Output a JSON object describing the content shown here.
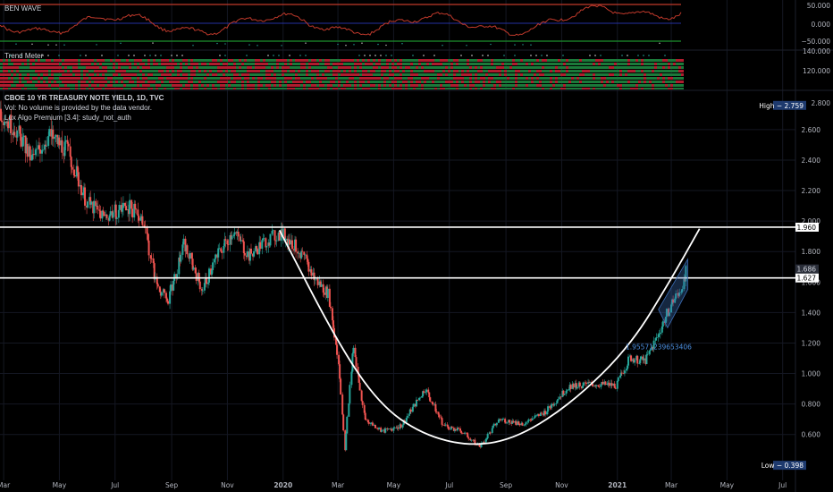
{
  "colors": {
    "background": "#000000",
    "grid": "#141722",
    "candle_up": "#26a69a",
    "candle_down": "#ef5350",
    "wave_line": "#c0392b",
    "wave_zero": "#2f3fd6",
    "wave_lower": "#1c8f2e",
    "wave_upper": "#c0392b",
    "cup_line": "#ffffff",
    "channel": "#3d6fb8",
    "annotation": "#4c8fe0",
    "high_low_tag": "#1e3a6e"
  },
  "header": {
    "ben_wave_title": "BEN WAVE",
    "trend_meter_title": "Trend Meter",
    "symbol_line": "CBOE 10 YR TREASURY NOTE YIELD, 1D, TVC",
    "vol_line": "Vol: No volume is provided by the data vendor.",
    "algo_line": "Lux Algo Premium [3.4]: study_not_auth"
  },
  "ben_wave_axis": [
    "50.000",
    "0.000",
    "−50.000"
  ],
  "trend_meter_axis": [
    "140.000",
    "120.000"
  ],
  "annotation_text": "1.95571239653406",
  "price_tags": {
    "high": "High − 2.759",
    "low": "Low − 0.398",
    "level_upper": "1.960",
    "level_lower": "1.627",
    "last_price": "1.686",
    "cut_label": "2.800",
    "cut_label_2": "1.600"
  },
  "chart_data": {
    "type": "candlestick",
    "title": "CBOE 10 YR TREASURY NOTE YIELD, 1D, TVC",
    "y_ticks": [
      2.6,
      2.4,
      2.2,
      2.0,
      1.8,
      1.4,
      1.2,
      1.0,
      0.8,
      0.6
    ],
    "y_tick_labels": [
      "2.600",
      "2.400",
      "2.200",
      "2.000",
      "1.800",
      "1.400",
      "1.200",
      "1.000",
      "0.800",
      "0.600"
    ],
    "ylim": [
      0.34,
      2.84
    ],
    "x_labels": [
      "Mar",
      "May",
      "Jul",
      "Sep",
      "Nov",
      "2020",
      "Mar",
      "May",
      "Jul",
      "Sep",
      "Nov",
      "2021",
      "Mar",
      "May",
      "Jul"
    ],
    "x_label_dates": [
      "2019-03-01",
      "2019-05-01",
      "2019-07-01",
      "2019-09-01",
      "2019-11-01",
      "2020-01-01",
      "2020-03-01",
      "2020-05-01",
      "2020-07-01",
      "2020-09-01",
      "2020-11-01",
      "2021-01-01",
      "2021-03-01",
      "2021-05-01",
      "2021-07-01"
    ],
    "x_range": [
      "2019-02-25",
      "2021-07-15"
    ],
    "grid": true,
    "price_path": [
      {
        "date": "2019-02-25",
        "y": 2.72
      },
      {
        "date": "2019-03-15",
        "y": 2.6
      },
      {
        "date": "2019-04-01",
        "y": 2.4
      },
      {
        "date": "2019-04-20",
        "y": 2.56
      },
      {
        "date": "2019-05-10",
        "y": 2.47
      },
      {
        "date": "2019-06-01",
        "y": 2.12
      },
      {
        "date": "2019-06-20",
        "y": 2.03
      },
      {
        "date": "2019-07-15",
        "y": 2.1
      },
      {
        "date": "2019-08-01",
        "y": 2.02
      },
      {
        "date": "2019-08-15",
        "y": 1.6
      },
      {
        "date": "2019-08-28",
        "y": 1.47
      },
      {
        "date": "2019-09-15",
        "y": 1.85
      },
      {
        "date": "2019-10-05",
        "y": 1.55
      },
      {
        "date": "2019-10-20",
        "y": 1.76
      },
      {
        "date": "2019-11-08",
        "y": 1.94
      },
      {
        "date": "2019-11-25",
        "y": 1.77
      },
      {
        "date": "2019-12-15",
        "y": 1.88
      },
      {
        "date": "2019-12-31",
        "y": 1.92
      },
      {
        "date": "2020-01-20",
        "y": 1.8
      },
      {
        "date": "2020-02-05",
        "y": 1.62
      },
      {
        "date": "2020-02-20",
        "y": 1.52
      },
      {
        "date": "2020-03-02",
        "y": 1.08
      },
      {
        "date": "2020-03-09",
        "y": 0.5
      },
      {
        "date": "2020-03-18",
        "y": 1.18
      },
      {
        "date": "2020-03-31",
        "y": 0.7
      },
      {
        "date": "2020-04-20",
        "y": 0.62
      },
      {
        "date": "2020-05-10",
        "y": 0.66
      },
      {
        "date": "2020-06-05",
        "y": 0.9
      },
      {
        "date": "2020-06-25",
        "y": 0.66
      },
      {
        "date": "2020-07-15",
        "y": 0.62
      },
      {
        "date": "2020-08-04",
        "y": 0.52
      },
      {
        "date": "2020-08-25",
        "y": 0.7
      },
      {
        "date": "2020-09-20",
        "y": 0.67
      },
      {
        "date": "2020-10-15",
        "y": 0.75
      },
      {
        "date": "2020-11-10",
        "y": 0.92
      },
      {
        "date": "2020-12-05",
        "y": 0.93
      },
      {
        "date": "2020-12-31",
        "y": 0.92
      },
      {
        "date": "2021-01-15",
        "y": 1.1
      },
      {
        "date": "2021-02-01",
        "y": 1.08
      },
      {
        "date": "2021-02-15",
        "y": 1.25
      },
      {
        "date": "2021-03-01",
        "y": 1.45
      },
      {
        "date": "2021-03-10",
        "y": 1.53
      },
      {
        "date": "2021-03-19",
        "y": 1.686
      }
    ],
    "horizontal_levels": [
      1.96,
      1.627
    ],
    "cup_curve": [
      {
        "date": "2019-12-28",
        "y": 1.94
      },
      {
        "date": "2020-03-01",
        "y": 1.2
      },
      {
        "date": "2020-04-15",
        "y": 0.8
      },
      {
        "date": "2020-06-01",
        "y": 0.6
      },
      {
        "date": "2020-07-25",
        "y": 0.52
      },
      {
        "date": "2020-09-15",
        "y": 0.58
      },
      {
        "date": "2020-11-15",
        "y": 0.82
      },
      {
        "date": "2021-01-15",
        "y": 1.18
      },
      {
        "date": "2021-03-01",
        "y": 1.62
      },
      {
        "date": "2021-04-01",
        "y": 1.95
      }
    ],
    "channel": [
      {
        "date": "2021-02-15",
        "y": 1.42
      },
      {
        "date": "2021-03-19",
        "y": 1.75
      },
      {
        "date": "2021-02-25",
        "y": 1.3
      },
      {
        "date": "2021-03-19",
        "y": 1.55
      }
    ]
  }
}
